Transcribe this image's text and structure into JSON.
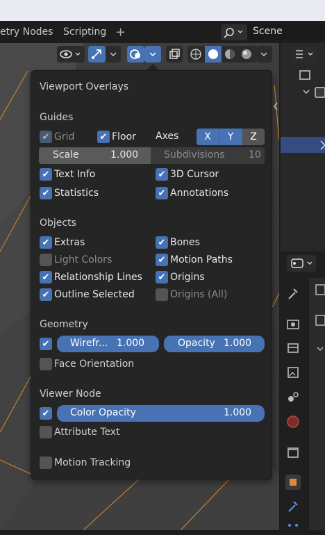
{
  "tabs": [
    {
      "label": "etry Nodes"
    },
    {
      "label": "Scripting"
    }
  ],
  "tab_add": "+",
  "scene": {
    "name": "Scene"
  },
  "overlay": {
    "title": "Viewport Overlays",
    "guides": {
      "header": "Guides",
      "grid": {
        "label": "Grid",
        "checked": true,
        "enabled": false
      },
      "floor": {
        "label": "Floor",
        "checked": true
      },
      "axes_label": "Axes",
      "axes": [
        "X",
        "Y",
        "Z"
      ],
      "scale_label": "Scale",
      "scale_value": "1.000",
      "subdivisions_label": "Subdivisions",
      "subdivisions_value": "10",
      "text_info": {
        "label": "Text Info",
        "checked": true
      },
      "cursor_3d": {
        "label": "3D Cursor",
        "checked": true
      },
      "statistics": {
        "label": "Statistics",
        "checked": true
      },
      "annotations": {
        "label": "Annotations",
        "checked": true
      }
    },
    "objects": {
      "header": "Objects",
      "extras": {
        "label": "Extras",
        "checked": true
      },
      "bones": {
        "label": "Bones",
        "checked": true
      },
      "light_colors": {
        "label": "Light Colors",
        "checked": false
      },
      "motion_paths": {
        "label": "Motion Paths",
        "checked": true
      },
      "relationship_lines": {
        "label": "Relationship Lines",
        "checked": true
      },
      "origins": {
        "label": "Origins",
        "checked": true
      },
      "outline_selected": {
        "label": "Outline Selected",
        "checked": true
      },
      "origins_all": {
        "label": "Origins (All)",
        "checked": false
      }
    },
    "geometry": {
      "header": "Geometry",
      "wireframe_label": "Wirefr...",
      "wireframe_value": "1.000",
      "opacity_label": "Opacity",
      "opacity_value": "1.000",
      "face_orientation": {
        "label": "Face Orientation",
        "checked": false
      }
    },
    "viewer_node": {
      "header": "Viewer Node",
      "color_opacity_label": "Color Opacity",
      "color_opacity_value": "1.000",
      "attribute_text": {
        "label": "Attribute Text",
        "checked": false
      }
    },
    "motion_tracking": {
      "label": "Motion Tracking",
      "checked": false
    }
  },
  "colors": {
    "accent": "#4772b3",
    "panel_bg": "#252525",
    "viewport_bg": "#3b3b3b",
    "orange_edges": "#d98a2b"
  }
}
